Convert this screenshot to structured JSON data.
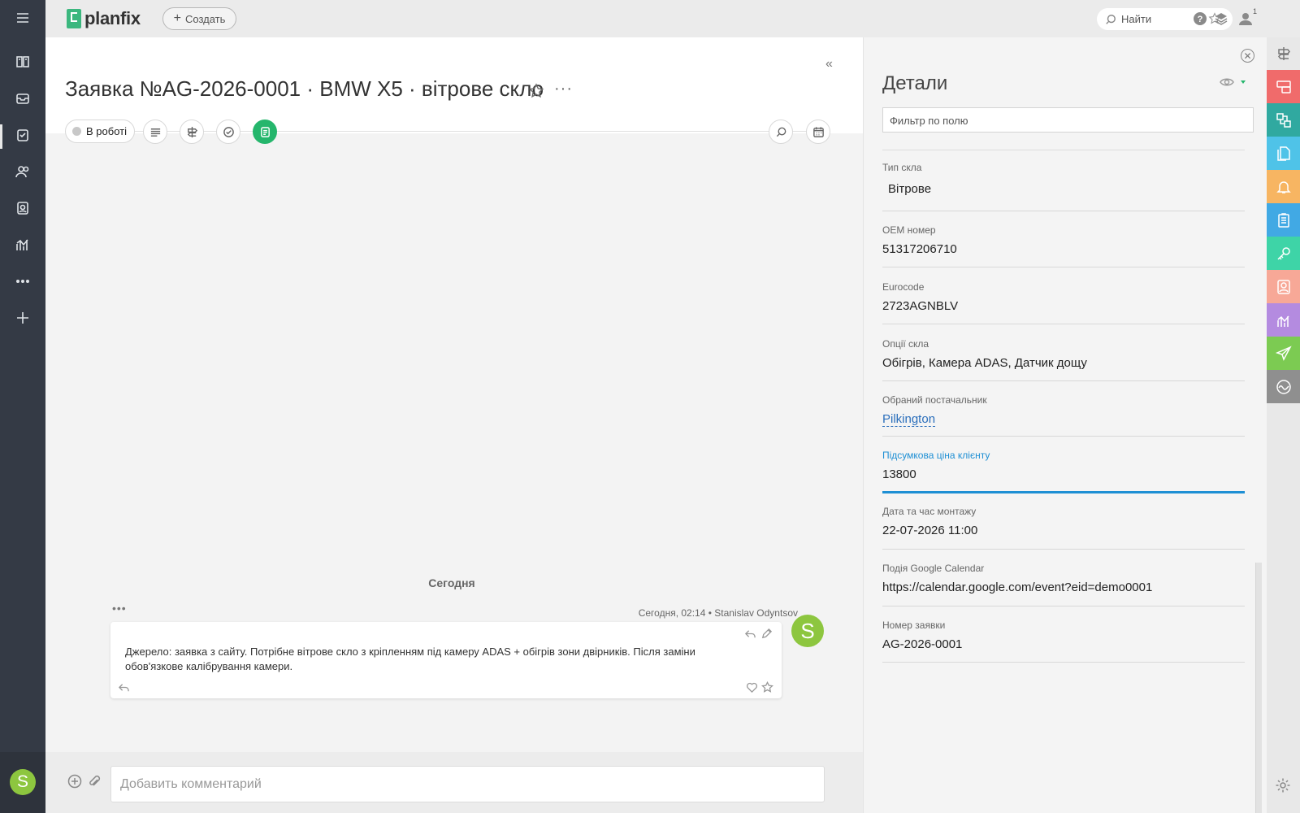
{
  "app": {
    "logo_text": "planfix"
  },
  "topbar": {
    "create_label": "Создать",
    "search_label": "Найти",
    "user_badge": "1"
  },
  "task": {
    "title": "Заявка №AG-2026-0001 · BMW X5 · вітрове скло",
    "status": "В роботі"
  },
  "chat": {
    "day_label": "Сегодня",
    "message": {
      "meta": "Сегодня, 02:14 • Stanislav Odyntsov",
      "avatar_letter": "S",
      "text": "Джерело: заявка з сайту. Потрібне вітрове скло з кріпленням під камеру ADAS + обігрів зони двірників. Після заміни обов'язкове калібрування камери."
    },
    "comment_placeholder": "Добавить комментарий"
  },
  "user": {
    "avatar_letter": "S"
  },
  "details": {
    "title": "Детали",
    "filter_placeholder": "Фильтр по полю",
    "fields": [
      {
        "label": "Тип скла",
        "value": "Вітрове"
      },
      {
        "label": "OEM номер",
        "value": "51317206710"
      },
      {
        "label": "Eurocode",
        "value": "2723AGNBLV"
      },
      {
        "label": "Опції скла",
        "value": "Обігрів, Камера ADAS, Датчик дощу"
      },
      {
        "label": "Обраний постачальник",
        "value": "Pilkington"
      },
      {
        "label": "Підсумкова ціна клієнту",
        "value": "13800"
      },
      {
        "label": "Дата та час монтажу",
        "value": "22-07-2026 11:00"
      },
      {
        "label": "Подія Google Calendar",
        "value": "https://calendar.google.com/event?eid=demo0001"
      },
      {
        "label": "Номер заявки",
        "value": "AG-2026-0001"
      }
    ]
  },
  "rail_colors": [
    "#f06b6b",
    "#30a9a0",
    "#4fc3e8",
    "#f7b562",
    "#41a9e4",
    "#3ed4a7",
    "#f7a897",
    "#b48be0",
    "#7ccb52",
    "#8f8f8f"
  ],
  "colors": {
    "accent_green": "#25b66c",
    "active_field": "#1e8fd4",
    "link": "#2a6ebb"
  }
}
